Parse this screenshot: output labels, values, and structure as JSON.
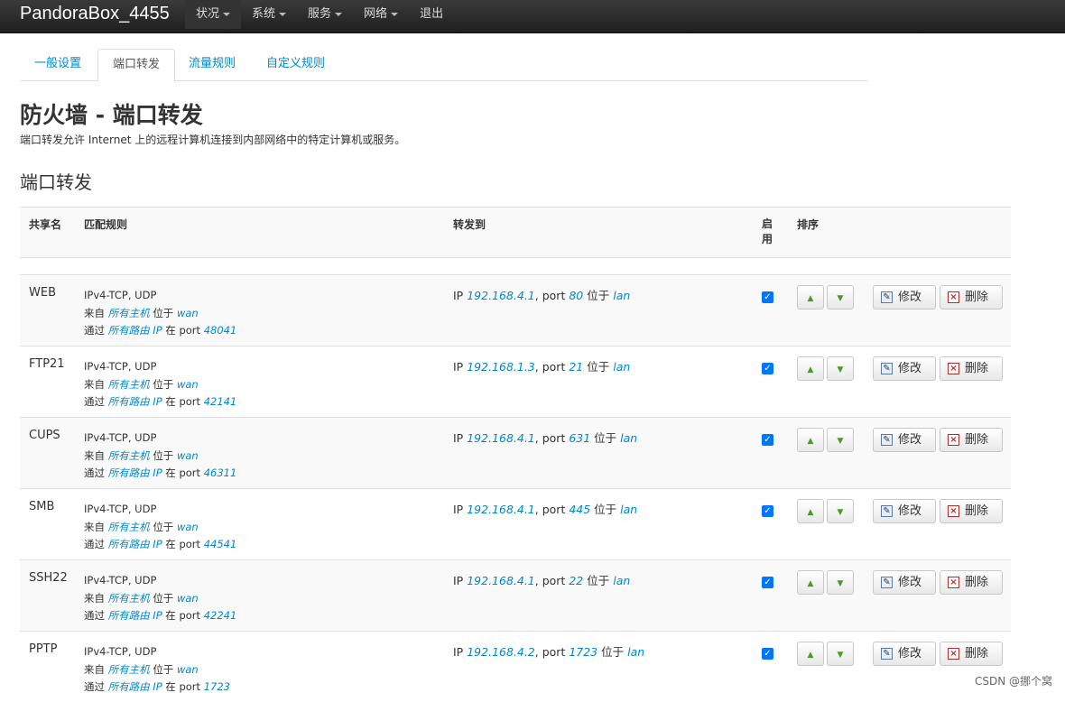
{
  "app": {
    "brand": "PandoraBox_4455",
    "menu": [
      {
        "label": "状况",
        "dropdown": true
      },
      {
        "label": "系统",
        "dropdown": true
      },
      {
        "label": "服务",
        "dropdown": true
      },
      {
        "label": "网络",
        "dropdown": true
      },
      {
        "label": "退出",
        "dropdown": false
      }
    ]
  },
  "tabs": [
    {
      "label": "一般设置",
      "active": false
    },
    {
      "label": "端口转发",
      "active": true
    },
    {
      "label": "流量规则",
      "active": false
    },
    {
      "label": "自定义规则",
      "active": false
    }
  ],
  "page": {
    "title": "防火墙 - 端口转发",
    "description": "端口转发允许 Internet 上的远程计算机连接到内部网络中的特定计算机或服务。",
    "section_title": "端口转发"
  },
  "table": {
    "headers": {
      "name": "共享名",
      "match": "匹配规则",
      "forward": "转发到",
      "enable": "启用",
      "sort": "排序"
    },
    "labels": {
      "from": "来自",
      "at": "位于",
      "via": "通过",
      "in": "在",
      "port": "port",
      "ip": "IP",
      "all_hosts": "所有主机",
      "all_router_ip": "所有路由 IP",
      "edit": "修改",
      "delete": "删除"
    },
    "rows": [
      {
        "name": "WEB",
        "proto": "IPv4-TCP, UDP",
        "src_zone": "wan",
        "ext_port": "48041",
        "dest_ip": "192.168.4.1",
        "dest_port": "80",
        "dest_zone": "lan",
        "enabled": true
      },
      {
        "name": "FTP21",
        "proto": "IPv4-TCP, UDP",
        "src_zone": "wan",
        "ext_port": "42141",
        "dest_ip": "192.168.1.3",
        "dest_port": "21",
        "dest_zone": "lan",
        "enabled": true
      },
      {
        "name": "CUPS",
        "proto": "IPv4-TCP, UDP",
        "src_zone": "wan",
        "ext_port": "46311",
        "dest_ip": "192.168.4.1",
        "dest_port": "631",
        "dest_zone": "lan",
        "enabled": true
      },
      {
        "name": "SMB",
        "proto": "IPv4-TCP, UDP",
        "src_zone": "wan",
        "ext_port": "44541",
        "dest_ip": "192.168.4.1",
        "dest_port": "445",
        "dest_zone": "lan",
        "enabled": true
      },
      {
        "name": "SSH22",
        "proto": "IPv4-TCP, UDP",
        "src_zone": "wan",
        "ext_port": "42241",
        "dest_ip": "192.168.4.1",
        "dest_port": "22",
        "dest_zone": "lan",
        "enabled": true
      },
      {
        "name": "PPTP",
        "proto": "IPv4-TCP, UDP",
        "src_zone": "wan",
        "ext_port": "1723",
        "dest_ip": "192.168.4.2",
        "dest_port": "1723",
        "dest_zone": "lan",
        "enabled": true
      }
    ]
  },
  "watermark": "CSDN @挪个窝"
}
